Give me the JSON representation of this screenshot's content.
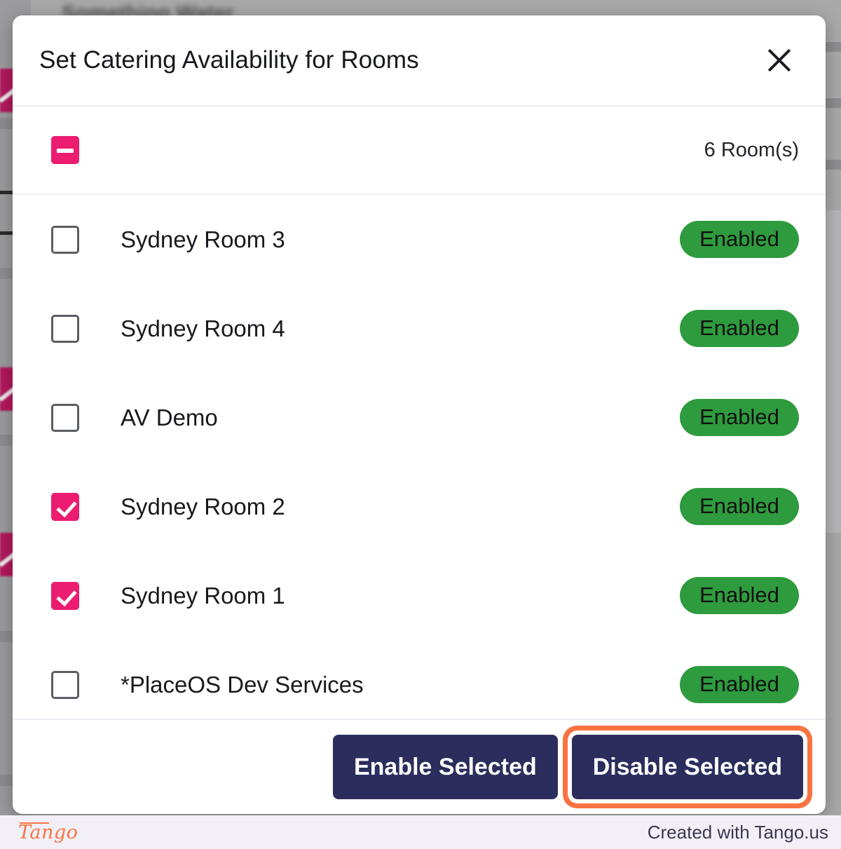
{
  "modal": {
    "title": "Set Catering Availability for Rooms",
    "close_icon": "close-icon",
    "select_all": {
      "state": "indeterminate",
      "count_label": "6 Room(s)"
    },
    "rooms": [
      {
        "name": "Sydney Room 3",
        "checked": false,
        "status": "Enabled"
      },
      {
        "name": "Sydney Room 4",
        "checked": false,
        "status": "Enabled"
      },
      {
        "name": "AV Demo",
        "checked": false,
        "status": "Enabled"
      },
      {
        "name": "Sydney Room 2",
        "checked": true,
        "status": "Enabled"
      },
      {
        "name": "Sydney Room 1",
        "checked": true,
        "status": "Enabled"
      },
      {
        "name": "*PlaceOS Dev Services",
        "checked": false,
        "status": "Enabled"
      }
    ],
    "footer": {
      "enable_label": "Enable Selected",
      "disable_label": "Disable Selected",
      "highlighted_button": "disable-selected-button"
    }
  },
  "tango_bar": {
    "logo_text": "Tango",
    "credit_text": "Created with Tango.us"
  },
  "colors": {
    "accent_pink": "#ec1d70",
    "badge_green": "#2e9b3e",
    "button_navy": "#2b2e5c",
    "highlight_orange": "#f97341",
    "divider": "#eceef3"
  }
}
